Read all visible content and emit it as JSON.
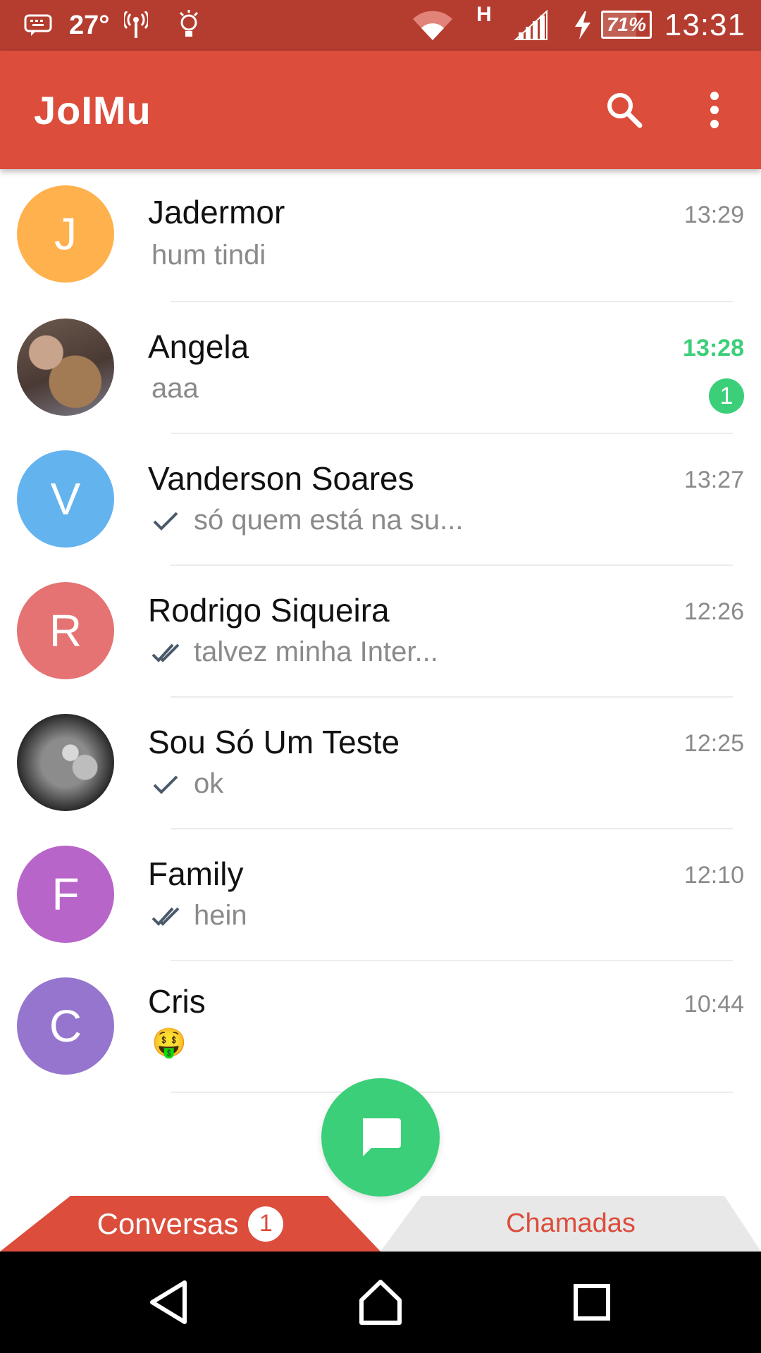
{
  "status_bar": {
    "temperature": "27°",
    "network_type": "H",
    "battery": "71%",
    "battery_level": 0.71,
    "time": "13:31",
    "background": "#b43d30"
  },
  "app_bar": {
    "title": "JoIMu",
    "actions": [
      "search-icon",
      "more-vert-icon"
    ],
    "color": "#dc4d3c"
  },
  "chats": [
    {
      "name": "Jadermor",
      "time": "13:29",
      "preview": "hum tindi",
      "avatar_letter": "J",
      "avatar_color": "#ffb14d",
      "status": "none"
    },
    {
      "name": "Angela",
      "time": "13:28",
      "preview": "aaa",
      "avatar_letter": "",
      "avatar_color": "#8a6a56",
      "status": "none",
      "unread": "1"
    },
    {
      "name": "Vanderson Soares",
      "time": "13:27",
      "preview": "só quem está na su...",
      "avatar_letter": "V",
      "avatar_color": "#63b3ef",
      "status": "sent"
    },
    {
      "name": "Rodrigo Siqueira",
      "time": "12:26",
      "preview": "talvez minha Inter...",
      "avatar_letter": "R",
      "avatar_color": "#e57373",
      "status": "read"
    },
    {
      "name": "Sou Só Um Teste",
      "time": "12:25",
      "preview": "ok",
      "avatar_letter": "",
      "avatar_color": "#5a5a5a",
      "status": "sent"
    },
    {
      "name": "Family",
      "time": "12:10",
      "preview": "hein",
      "avatar_letter": "F",
      "avatar_color": "#b865c9",
      "status": "read"
    },
    {
      "name": "Cris",
      "time": "10:44",
      "preview": "🤑",
      "avatar_letter": "C",
      "avatar_color": "#9575cd",
      "status": "none"
    }
  ],
  "fab": {
    "icon": "chat-bubble-icon",
    "color": "#3ccf7a"
  },
  "tabs": {
    "conversations": {
      "label": "Conversas",
      "badge": "1",
      "active": true
    },
    "calls": {
      "label": "Chamadas",
      "active": false
    }
  },
  "navigation_bar": {
    "buttons": [
      "back-icon",
      "home-icon",
      "recents-icon"
    ]
  }
}
